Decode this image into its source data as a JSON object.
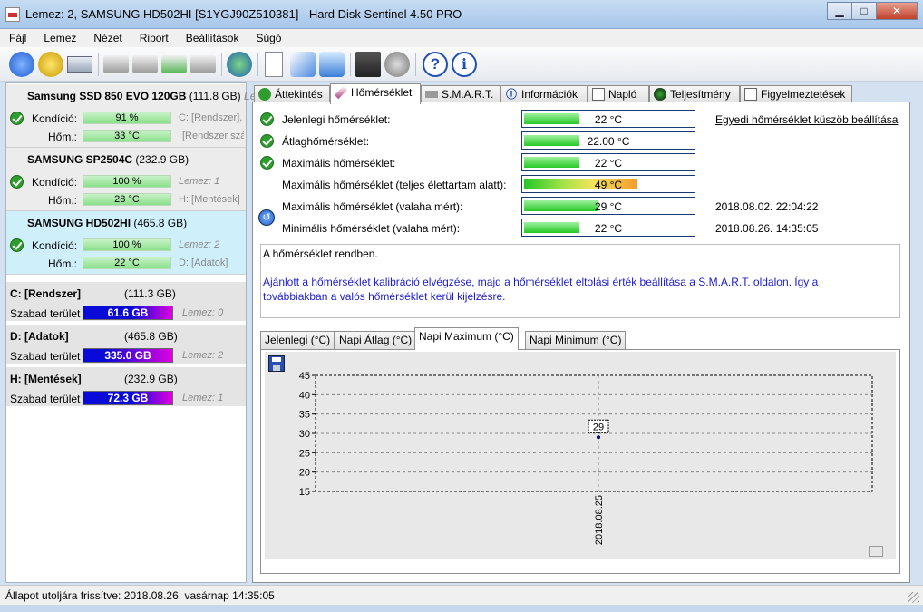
{
  "window": {
    "title": "Lemez: 2, SAMSUNG HD502HI [S1YGJ90Z510381]  -  Hard Disk Sentinel 4.50 PRO",
    "minimize": "▁",
    "maximize": "□",
    "close": "✕"
  },
  "menu": [
    "Fájl",
    "Lemez",
    "Nézet",
    "Riport",
    "Beállítások",
    "Súgó"
  ],
  "disks": [
    {
      "name": "Samsung SSD 850 EVO 120GB",
      "size": "(111.8 GB)",
      "sub": "Le",
      "health_label": "Kondíció:",
      "health": "91 %",
      "health_extra": "C: [Rendszer],",
      "temp_label": "Hőm.:",
      "temp": "33 °C",
      "temp_extra": "[Rendszer szá"
    },
    {
      "name": "SAMSUNG SP2504C",
      "size": "(232.9 GB)",
      "health_label": "Kondíció:",
      "health": "100 %",
      "health_extra": "Lemez: 1",
      "temp_label": "Hőm.:",
      "temp": "28 °C",
      "temp_extra": "H: [Mentések]"
    },
    {
      "name": "SAMSUNG HD502HI",
      "size": "(465.8 GB)",
      "health_label": "Kondíció:",
      "health": "100 %",
      "health_extra": "Lemez: 2",
      "temp_label": "Hőm.:",
      "temp": "22 °C",
      "temp_extra": "D: [Adatok]"
    }
  ],
  "volumes": [
    {
      "name": "C: [Rendszer]",
      "size": "(111.3 GB)",
      "free_label": "Szabad terület",
      "free": "61.6 GB",
      "disk": "Lemez: 0"
    },
    {
      "name": "D: [Adatok]",
      "size": "(465.8 GB)",
      "free_label": "Szabad terület",
      "free": "335.0 GB",
      "disk": "Lemez: 2"
    },
    {
      "name": "H: [Mentések]",
      "size": "(232.9 GB)",
      "free_label": "Szabad terület",
      "free": "72.3 GB",
      "disk": "Lemez: 1"
    }
  ],
  "tabs": [
    "Áttekintés",
    "Hőmérséklet",
    "S.M.A.R.T.",
    "Információk",
    "Napló",
    "Teljesítmény",
    "Figyelmeztetések"
  ],
  "temperature": {
    "rows": [
      {
        "label": "Jelenlegi hőmérséklet:",
        "value": "22 °C",
        "extra": "Egyedi hőmérséklet küszöb beállítása",
        "fill_pct": 33
      },
      {
        "label": "Átlaghőmérséklet:",
        "value": "22.00 °C",
        "extra": "",
        "fill_pct": 33
      },
      {
        "label": "Maximális hőmérséklet:",
        "value": "22 °C",
        "extra": "",
        "fill_pct": 33
      },
      {
        "label": "Maximális hőmérséklet (teljes élettartam alatt):",
        "value": "49 °C",
        "extra": "",
        "fill_pct": 67
      },
      {
        "label": "Maximális hőmérséklet (valaha mért):",
        "value": "29 °C",
        "extra": "2018.08.02. 22:04:22",
        "fill_pct": 44
      },
      {
        "label": "Minimális hőmérséklet (valaha mért):",
        "value": "22 °C",
        "extra": "2018.08.26. 14:35:05",
        "fill_pct": 33
      }
    ],
    "message_line1": "A hőmérséklet rendben.",
    "message_line2": "Ajánlott a hőmérséklet kalibráció elvégzése, majd a hőmérséklet eltolási érték beállítása a S.M.A.R.T. oldalon. Így a továbbiakban a valós hőmérséklet kerül kijelzésre."
  },
  "chart_tabs": [
    "Jelenlegi (°C)",
    "Napi Átlag (°C)",
    "Napi Maximum (°C)",
    "Napi Minimum (°C)"
  ],
  "chart_data": {
    "type": "scatter",
    "title": "",
    "xlabel": "",
    "ylabel": "",
    "x": [
      "2018.08.25"
    ],
    "y": [
      29
    ],
    "data_labels": [
      "29"
    ],
    "yticks": [
      15,
      20,
      25,
      30,
      35,
      40,
      45
    ],
    "ylim": [
      15,
      45
    ],
    "grid": true
  },
  "status": {
    "text": "Állapot utoljára frissítve: 2018.08.26. vasárnap 14:35:05"
  },
  "colors": {
    "accent": "#1c1ccc",
    "health_bar": "#8be08b",
    "selected_disk": "#cff0fb"
  }
}
